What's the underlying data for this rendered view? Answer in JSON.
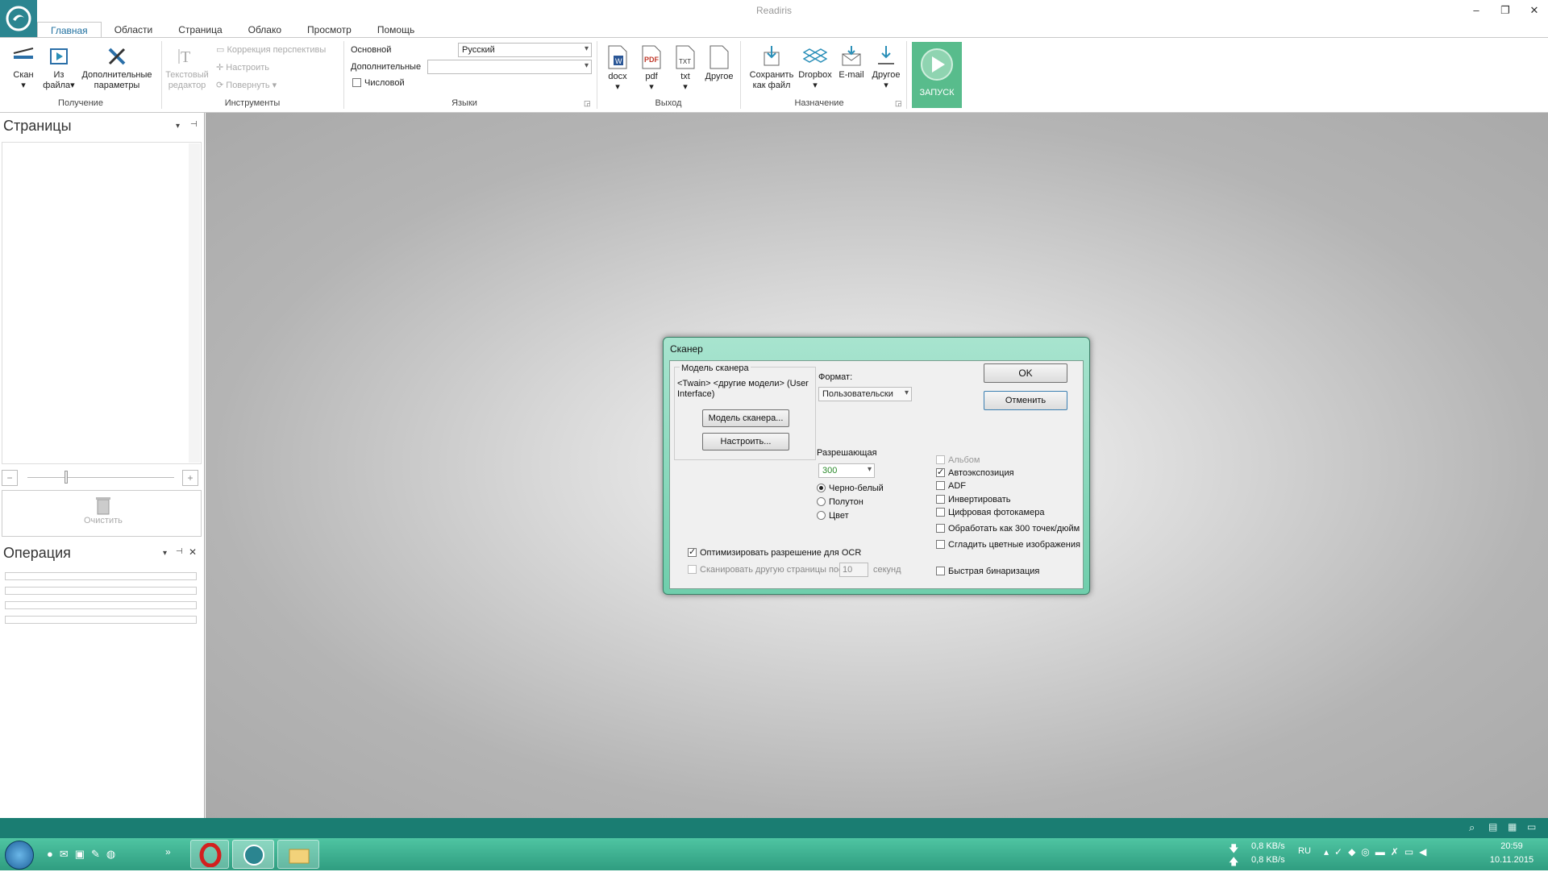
{
  "window": {
    "title": "Readiris"
  },
  "tabs": [
    "Главная",
    "Области",
    "Страница",
    "Облако",
    "Просмотр",
    "Помощь"
  ],
  "ribbon": {
    "acquire": {
      "scan": "Скан",
      "from_file": "Из файла",
      "params": "Дополнительные параметры",
      "group": "Получение"
    },
    "tools": {
      "text_editor": "Текстовый редактор",
      "perspective": "Коррекция перспективы",
      "adjust": "Настроить",
      "rotate": "Повернуть",
      "group": "Инструменты"
    },
    "languages": {
      "main_label": "Основной",
      "main_value": "Русский",
      "extra_label": "Дополнительные",
      "extra_value": "",
      "numeric": "Числовой",
      "group": "Языки"
    },
    "output": {
      "docx": "docx",
      "pdf": "pdf",
      "txt": "txt",
      "other": "Другое",
      "group": "Выход",
      "docx_badge": "W",
      "pdf_badge": "PDF",
      "txt_badge": "TXT"
    },
    "destination": {
      "save": "Сохранить как файл",
      "dropbox": "Dropbox",
      "email": "E-mail",
      "other": "Другое",
      "group": "Назначение"
    },
    "run": "ЗАПУСК"
  },
  "pages_panel": {
    "title": "Страницы",
    "clear": "Очистить"
  },
  "ops_panel": {
    "title": "Операция"
  },
  "dialog": {
    "title": "Сканер",
    "model_group": "Модель сканера",
    "model_text": "<Twain> <другие модели> (User Interface)",
    "model_btn": "Модель сканера...",
    "setup_btn": "Настроить...",
    "format_label": "Формат:",
    "format_value": "Пользовательски",
    "res_label": "Разрешающая",
    "res_value": "300",
    "mode_bw": "Черно-белый",
    "mode_gray": "Полутон",
    "mode_color": "Цвет",
    "ok": "OK",
    "cancel": "Отменить",
    "album": "Альбом",
    "autoexp": "Автоэкспозиция",
    "adf": "ADF",
    "invert": "Инвертировать",
    "camera": "Цифровая фотокамера",
    "as300": "Обработать как 300 точек/дюйм",
    "smooth": "Сгладить цветные изображения",
    "optimize": "Оптимизировать разрешение для OCR",
    "scan_other": "Сканировать другую страницы посл",
    "seconds_value": "10",
    "seconds": "секунд",
    "fastbin": "Быстрая бинаризация"
  },
  "tray": {
    "speed_down": "0,8 KB/s",
    "speed_up": "0,8 KB/s",
    "lang": "RU",
    "time": "20:59",
    "date": "10.11.2015"
  }
}
